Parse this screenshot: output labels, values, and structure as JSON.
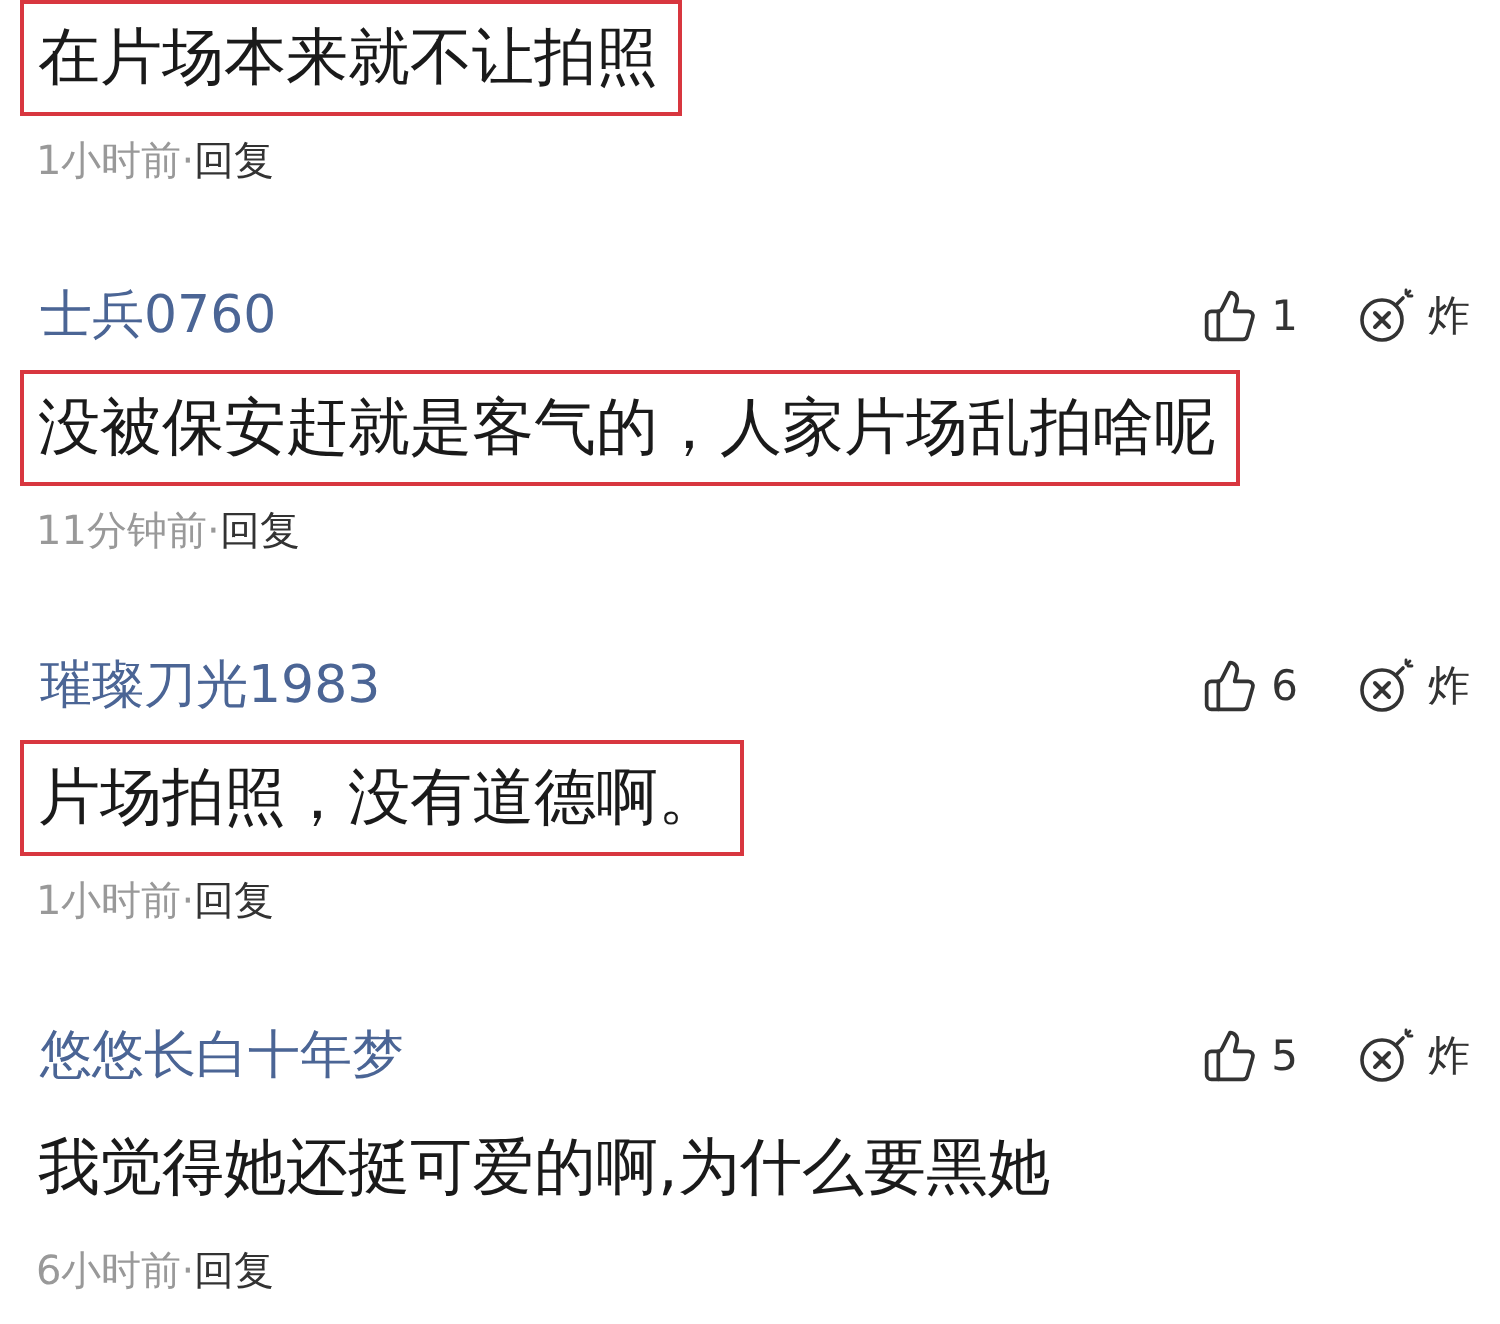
{
  "comments": [
    {
      "text": "在片场本来就不让拍照",
      "highlighted": true,
      "time": "1小时前·",
      "reply": "回复"
    },
    {
      "author": "士兵0760",
      "likes": "1",
      "bomb_label": "炸",
      "text": "没被保安赶就是客气的，人家片场乱拍啥呢",
      "highlighted": true,
      "time": "11分钟前·",
      "reply": "回复"
    },
    {
      "author": "璀璨刀光1983",
      "likes": "6",
      "bomb_label": "炸",
      "text": "片场拍照，没有道德啊。",
      "highlighted": true,
      "time": "1小时前·",
      "reply": "回复"
    },
    {
      "author": "悠悠长白十年梦",
      "likes": "5",
      "bomb_label": "炸",
      "text": "我觉得她还挺可爱的啊,为什么要黑她",
      "highlighted": false,
      "time": "6小时前·",
      "reply": "回复"
    }
  ]
}
